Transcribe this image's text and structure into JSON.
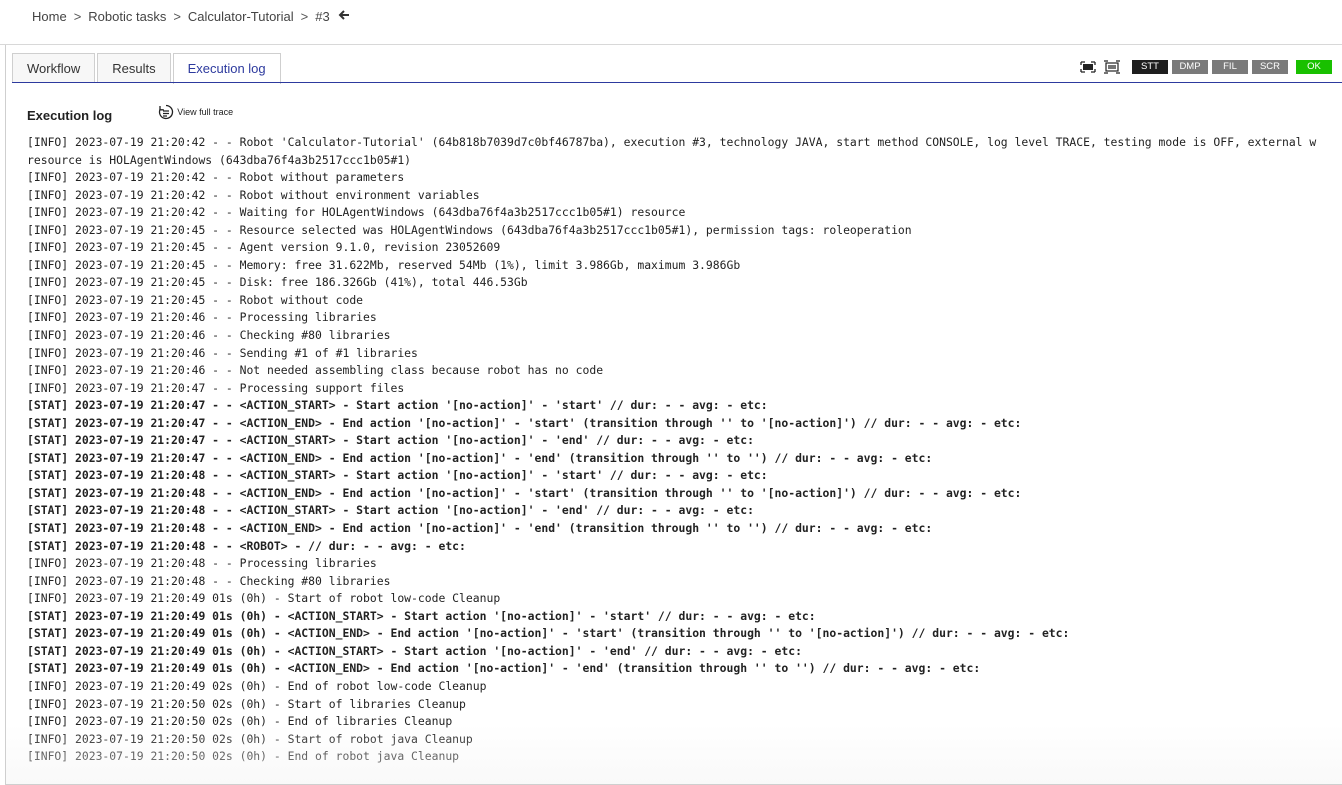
{
  "breadcrumb": {
    "items": [
      "Home",
      "Robotic tasks",
      "Calculator-Tutorial",
      "#3"
    ],
    "separator": ">",
    "back_icon": "arrow-left-icon"
  },
  "tabs": [
    {
      "label": "Workflow",
      "active": false
    },
    {
      "label": "Results",
      "active": false
    },
    {
      "label": "Execution log",
      "active": true
    }
  ],
  "toolbar": {
    "icons": [
      "expand-icon",
      "collapse-icon"
    ],
    "buttons": [
      {
        "label": "STT",
        "color": "#1e1e1e"
      },
      {
        "label": "DMP",
        "color": "#7a7a7a"
      },
      {
        "label": "FIL",
        "color": "#7a7a7a"
      },
      {
        "label": "SCR",
        "color": "#7a7a7a"
      },
      {
        "label": "OK",
        "color": "#19c000"
      }
    ]
  },
  "log": {
    "title": "Execution log",
    "full_trace_label": "View full trace",
    "full_trace_icon": "full-trace-icon",
    "lines": [
      {
        "text": "[INFO] 2023-07-19 21:20:42 - - Robot 'Calculator-Tutorial' (64b818b7039d7c0bf46787ba), execution #3, technology JAVA, start method CONSOLE, log level TRACE, testing mode is OFF, external w",
        "stat": false
      },
      {
        "text": "resource is HOLAgentWindows (643dba76f4a3b2517ccc1b05#1)",
        "stat": false
      },
      {
        "text": "[INFO] 2023-07-19 21:20:42 - - Robot without parameters",
        "stat": false
      },
      {
        "text": "[INFO] 2023-07-19 21:20:42 - - Robot without environment variables",
        "stat": false
      },
      {
        "text": "[INFO] 2023-07-19 21:20:42 - - Waiting for HOLAgentWindows (643dba76f4a3b2517ccc1b05#1) resource",
        "stat": false
      },
      {
        "text": "[INFO] 2023-07-19 21:20:45 - - Resource selected was HOLAgentWindows (643dba76f4a3b2517ccc1b05#1), permission tags: roleoperation",
        "stat": false
      },
      {
        "text": "[INFO] 2023-07-19 21:20:45 - - Agent version 9.1.0, revision 23052609",
        "stat": false
      },
      {
        "text": "[INFO] 2023-07-19 21:20:45 - - Memory: free 31.622Mb, reserved 54Mb (1%), limit 3.986Gb, maximum 3.986Gb",
        "stat": false
      },
      {
        "text": "[INFO] 2023-07-19 21:20:45 - - Disk: free 186.326Gb (41%), total 446.53Gb",
        "stat": false
      },
      {
        "text": "[INFO] 2023-07-19 21:20:45 - - Robot without code",
        "stat": false
      },
      {
        "text": "[INFO] 2023-07-19 21:20:46 - - Processing libraries",
        "stat": false
      },
      {
        "text": "[INFO] 2023-07-19 21:20:46 - - Checking #80 libraries",
        "stat": false
      },
      {
        "text": "[INFO] 2023-07-19 21:20:46 - - Sending #1 of #1 libraries",
        "stat": false
      },
      {
        "text": "[INFO] 2023-07-19 21:20:46 - - Not needed assembling class because robot has no code",
        "stat": false
      },
      {
        "text": "[INFO] 2023-07-19 21:20:47 - - Processing support files",
        "stat": false
      },
      {
        "text": "[STAT] 2023-07-19 21:20:47 - - <ACTION_START> - Start action '[no-action]' - 'start' // dur: - - avg: - etc:",
        "stat": true
      },
      {
        "text": "[STAT] 2023-07-19 21:20:47 - - <ACTION_END> - End action '[no-action]' - 'start' (transition through '' to '[no-action]') // dur: - - avg: - etc:",
        "stat": true
      },
      {
        "text": "[STAT] 2023-07-19 21:20:47 - - <ACTION_START> - Start action '[no-action]' - 'end' // dur: - - avg: - etc:",
        "stat": true
      },
      {
        "text": "[STAT] 2023-07-19 21:20:47 - - <ACTION_END> - End action '[no-action]' - 'end' (transition through '' to '') // dur: - - avg: - etc:",
        "stat": true
      },
      {
        "text": "[STAT] 2023-07-19 21:20:48 - - <ACTION_START> - Start action '[no-action]' - 'start' // dur: - - avg: - etc:",
        "stat": true
      },
      {
        "text": "[STAT] 2023-07-19 21:20:48 - - <ACTION_END> - End action '[no-action]' - 'start' (transition through '' to '[no-action]') // dur: - - avg: - etc:",
        "stat": true
      },
      {
        "text": "[STAT] 2023-07-19 21:20:48 - - <ACTION_START> - Start action '[no-action]' - 'end' // dur: - - avg: - etc:",
        "stat": true
      },
      {
        "text": "[STAT] 2023-07-19 21:20:48 - - <ACTION_END> - End action '[no-action]' - 'end' (transition through '' to '') // dur: - - avg: - etc:",
        "stat": true
      },
      {
        "text": "[STAT] 2023-07-19 21:20:48 - - <ROBOT> - // dur: - - avg: - etc:",
        "stat": true
      },
      {
        "text": "[INFO] 2023-07-19 21:20:48 - - Processing libraries",
        "stat": false
      },
      {
        "text": "[INFO] 2023-07-19 21:20:48 - - Checking #80 libraries",
        "stat": false
      },
      {
        "text": "[INFO] 2023-07-19 21:20:49 01s (0h) - Start of robot low-code Cleanup",
        "stat": false
      },
      {
        "text": "[STAT] 2023-07-19 21:20:49 01s (0h) - <ACTION_START> - Start action '[no-action]' - 'start' // dur: - - avg: - etc:",
        "stat": true
      },
      {
        "text": "[STAT] 2023-07-19 21:20:49 01s (0h) - <ACTION_END> - End action '[no-action]' - 'start' (transition through '' to '[no-action]') // dur: - - avg: - etc:",
        "stat": true
      },
      {
        "text": "[STAT] 2023-07-19 21:20:49 01s (0h) - <ACTION_START> - Start action '[no-action]' - 'end' // dur: - - avg: - etc:",
        "stat": true
      },
      {
        "text": "[STAT] 2023-07-19 21:20:49 01s (0h) - <ACTION_END> - End action '[no-action]' - 'end' (transition through '' to '') // dur: - - avg: - etc:",
        "stat": true
      },
      {
        "text": "[INFO] 2023-07-19 21:20:49 02s (0h) - End of robot low-code Cleanup",
        "stat": false
      },
      {
        "text": "[INFO] 2023-07-19 21:20:50 02s (0h) - Start of libraries Cleanup",
        "stat": false
      },
      {
        "text": "[INFO] 2023-07-19 21:20:50 02s (0h) - End of libraries Cleanup",
        "stat": false
      },
      {
        "text": "[INFO] 2023-07-19 21:20:50 02s (0h) - Start of robot java Cleanup",
        "stat": false
      },
      {
        "text": "[INFO] 2023-07-19 21:20:50 02s (0h) - End of robot java Cleanup",
        "stat": false
      }
    ]
  }
}
